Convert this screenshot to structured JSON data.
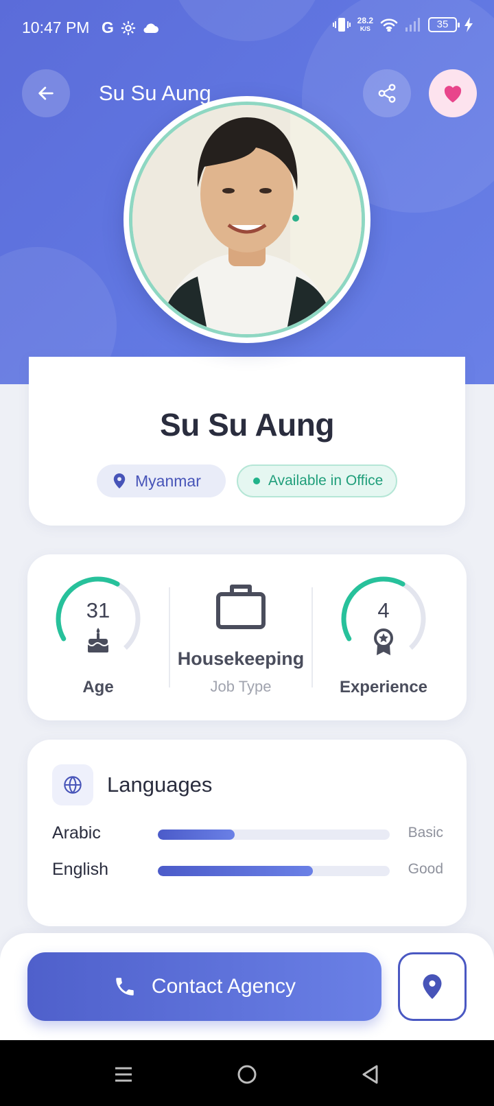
{
  "status_bar": {
    "time": "10:47 PM",
    "left_icons": [
      "google-icon",
      "settings-gear-icon",
      "cloud-icon"
    ],
    "net_speed_value": "28.2",
    "net_speed_unit": "K/S",
    "battery": "35",
    "right_icons": [
      "vibrate-icon",
      "wifi-icon",
      "signal-icon",
      "battery-icon",
      "charging-icon"
    ]
  },
  "header": {
    "title": "Su Su Aung",
    "back_icon": "arrow-left-icon",
    "share_icon": "share-icon",
    "favorite_icon": "heart-icon",
    "accent": "#5b6cd9",
    "favorite_color": "#e8458b"
  },
  "profile": {
    "name": "Su Su Aung",
    "location": "Myanmar",
    "availability": "Available in Office",
    "availability_color": "#21b38a"
  },
  "stats": {
    "age": {
      "value": "31",
      "label": "Age",
      "gauge_fraction": 0.62,
      "icon": "cake-icon"
    },
    "job": {
      "title": "Housekeeping",
      "subtitle": "Job Type",
      "icon": "briefcase-icon"
    },
    "experience": {
      "value": "4",
      "label": "Experience",
      "gauge_fraction": 0.62,
      "icon": "award-icon"
    }
  },
  "languages": {
    "title": "Languages",
    "icon": "globe-icon",
    "items": [
      {
        "name": "Arabic",
        "level": "Basic",
        "fraction": 0.33
      },
      {
        "name": "English",
        "level": "Good",
        "fraction": 0.67
      }
    ]
  },
  "actions": {
    "contact_label": "Contact Agency",
    "contact_icon": "phone-icon",
    "map_icon": "location-pin-icon"
  },
  "nav_bar": {
    "icons": [
      "menu-icon",
      "home-circle-icon",
      "back-triangle-icon"
    ]
  }
}
